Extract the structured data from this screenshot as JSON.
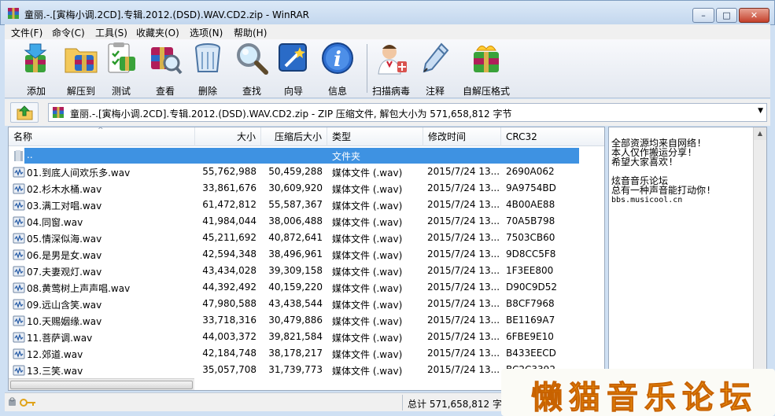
{
  "window": {
    "title": "童丽.-.[寅梅小调.2CD].专辑.2012.(DSD).WAV.CD2.zip - WinRAR",
    "min_glyph": "–",
    "max_glyph": "□",
    "close_glyph": "✕"
  },
  "menu": [
    "文件(F)",
    "命令(C)",
    "工具(S)",
    "收藏夹(O)",
    "选项(N)",
    "帮助(H)"
  ],
  "toolbar": [
    {
      "label": "添加",
      "icon": "add-archive-icon"
    },
    {
      "label": "解压到",
      "icon": "extract-to-icon"
    },
    {
      "label": "测试",
      "icon": "test-icon"
    },
    {
      "label": "查看",
      "icon": "view-icon"
    },
    {
      "label": "删除",
      "icon": "delete-icon"
    },
    {
      "label": "查找",
      "icon": "find-icon"
    },
    {
      "label": "向导",
      "icon": "wizard-icon"
    },
    {
      "label": "信息",
      "icon": "info-icon"
    },
    {
      "label": "扫描病毒",
      "icon": "scan-virus-icon"
    },
    {
      "label": "注释",
      "icon": "comment-icon"
    },
    {
      "label": "自解压格式",
      "icon": "sfx-icon"
    }
  ],
  "address": {
    "text": "童丽.-.[寅梅小调.2CD].专辑.2012.(DSD).WAV.CD2.zip - ZIP 压缩文件, 解包大小为 571,658,812 字节"
  },
  "columns": [
    "名称",
    "大小",
    "压缩后大小",
    "类型",
    "修改时间",
    "CRC32"
  ],
  "parent_row": {
    "name": "..",
    "type": "文件夹"
  },
  "files": [
    {
      "name": "01.到底人间欢乐多.wav",
      "size": "55,762,988",
      "packed": "50,459,288",
      "type": "媒体文件 (.wav)",
      "modified": "2015/7/24 13...",
      "crc": "2690A062"
    },
    {
      "name": "02.杉木水桶.wav",
      "size": "33,861,676",
      "packed": "30,609,920",
      "type": "媒体文件 (.wav)",
      "modified": "2015/7/24 13...",
      "crc": "9A9754BD"
    },
    {
      "name": "03.满工对唱.wav",
      "size": "61,472,812",
      "packed": "55,587,367",
      "type": "媒体文件 (.wav)",
      "modified": "2015/7/24 13...",
      "crc": "4B00AE88"
    },
    {
      "name": "04.同窗.wav",
      "size": "41,984,044",
      "packed": "38,006,488",
      "type": "媒体文件 (.wav)",
      "modified": "2015/7/24 13...",
      "crc": "70A5B798"
    },
    {
      "name": "05.情深似海.wav",
      "size": "45,211,692",
      "packed": "40,872,641",
      "type": "媒体文件 (.wav)",
      "modified": "2015/7/24 13...",
      "crc": "7503CB60"
    },
    {
      "name": "06.是男是女.wav",
      "size": "42,594,348",
      "packed": "38,496,961",
      "type": "媒体文件 (.wav)",
      "modified": "2015/7/24 13...",
      "crc": "9D8CC5F8"
    },
    {
      "name": "07.夫妻观灯.wav",
      "size": "43,434,028",
      "packed": "39,309,158",
      "type": "媒体文件 (.wav)",
      "modified": "2015/7/24 13...",
      "crc": "1F3EE800"
    },
    {
      "name": "08.黄莺树上声声唱.wav",
      "size": "44,392,492",
      "packed": "40,159,220",
      "type": "媒体文件 (.wav)",
      "modified": "2015/7/24 13...",
      "crc": "D90C9D52"
    },
    {
      "name": "09.远山含笑.wav",
      "size": "47,980,588",
      "packed": "43,438,544",
      "type": "媒体文件 (.wav)",
      "modified": "2015/7/24 13...",
      "crc": "B8CF7968"
    },
    {
      "name": "10.天赐姻缘.wav",
      "size": "33,718,316",
      "packed": "30,479,886",
      "type": "媒体文件 (.wav)",
      "modified": "2015/7/24 13...",
      "crc": "BE1169A7"
    },
    {
      "name": "11.菩萨调.wav",
      "size": "44,003,372",
      "packed": "39,821,584",
      "type": "媒体文件 (.wav)",
      "modified": "2015/7/24 13...",
      "crc": "6FBE9E10"
    },
    {
      "name": "12.郊道.wav",
      "size": "42,184,748",
      "packed": "38,178,217",
      "type": "媒体文件 (.wav)",
      "modified": "2015/7/24 13...",
      "crc": "B433EECD"
    },
    {
      "name": "13.三笑.wav",
      "size": "35,057,708",
      "packed": "31,739,773",
      "type": "媒体文件 (.wav)",
      "modified": "2015/7/24 13...",
      "crc": "BC2C3392"
    }
  ],
  "comment": {
    "lines": [
      "全部资源均来自网络!",
      "本人仅作搬运分享!",
      "希望大家喜欢!",
      "",
      "炫音音乐论坛",
      "总有一种声音能打动你!"
    ],
    "url": "bbs.musicool.cn"
  },
  "status": {
    "text": "总计 571,658,812 字节"
  },
  "watermark": {
    "text": "懒猫音乐论坛"
  },
  "colors": {
    "selection": "#3e92e2",
    "watermark": "#f39a12"
  }
}
